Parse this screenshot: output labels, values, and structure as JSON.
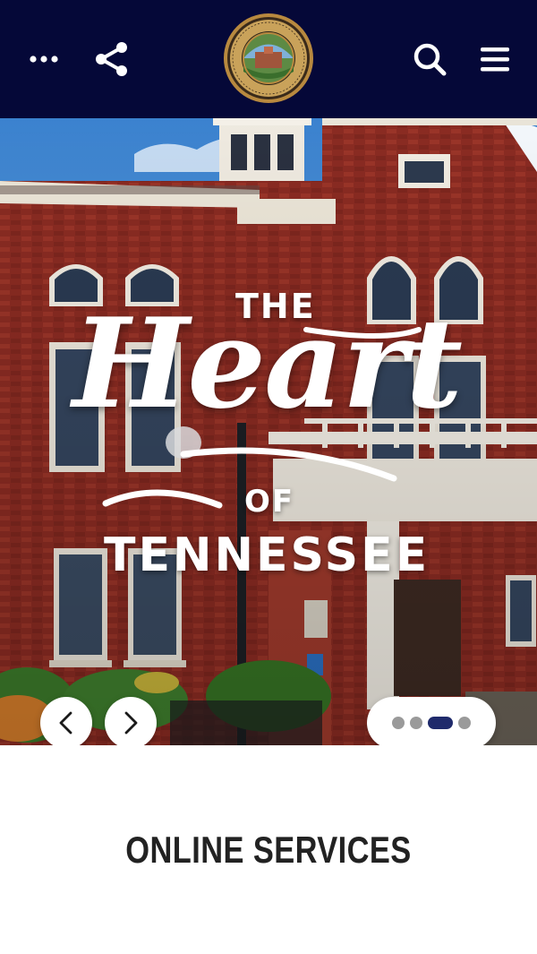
{
  "header": {
    "more_icon": "more-horizontal-icon",
    "share_icon": "share-icon",
    "logo_icon": "county-seal-icon",
    "search_icon": "search-icon",
    "menu_icon": "hamburger-menu-icon",
    "background_color": "#050838"
  },
  "hero": {
    "headline_the": "THE",
    "headline_script": "Heart",
    "headline_of": "OF",
    "headline_state": "TENNESSEE",
    "prev_icon": "chevron-left-icon",
    "next_icon": "chevron-right-icon",
    "slides_total": 4,
    "active_slide": 3
  },
  "content": {
    "section_title": "ONLINE SERVICES"
  }
}
